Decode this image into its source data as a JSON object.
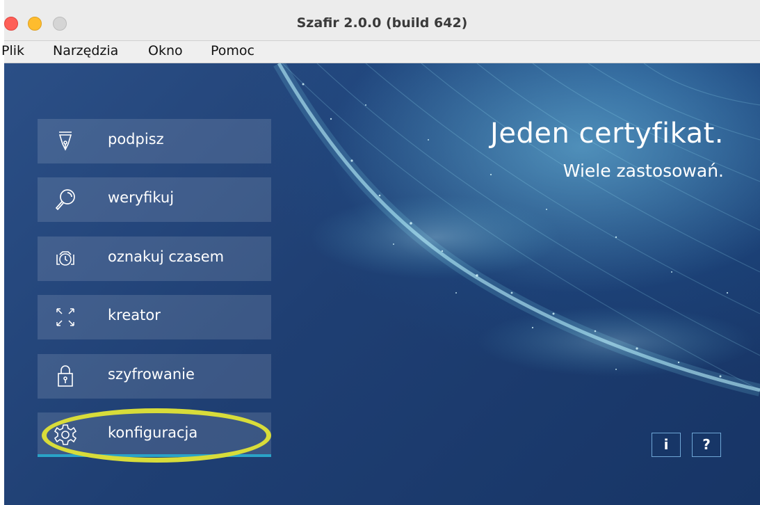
{
  "window": {
    "title": "Szafir 2.0.0 (build 642)"
  },
  "menu": {
    "items": [
      "Plik",
      "Narzędzia",
      "Okno",
      "Pomoc"
    ]
  },
  "actions": [
    {
      "label": "podpisz",
      "icon": "pen-nib-icon"
    },
    {
      "label": "weryfikuj",
      "icon": "magnifier-icon"
    },
    {
      "label": "oznakuj czasem",
      "icon": "timestamp-clock-icon"
    },
    {
      "label": "kreator",
      "icon": "expand-arrows-icon"
    },
    {
      "label": "szyfrowanie",
      "icon": "padlock-icon"
    },
    {
      "label": "konfiguracja",
      "icon": "gear-icon"
    }
  ],
  "slogan": {
    "line1": "Jeden certyfikat.",
    "line2": "Wiele zastosowań."
  },
  "corner_buttons": {
    "info": "i",
    "help": "?"
  },
  "colors": {
    "accent_underline": "#2aa3c7",
    "highlight": "#d8dc3a",
    "background": "#1f3f73"
  }
}
